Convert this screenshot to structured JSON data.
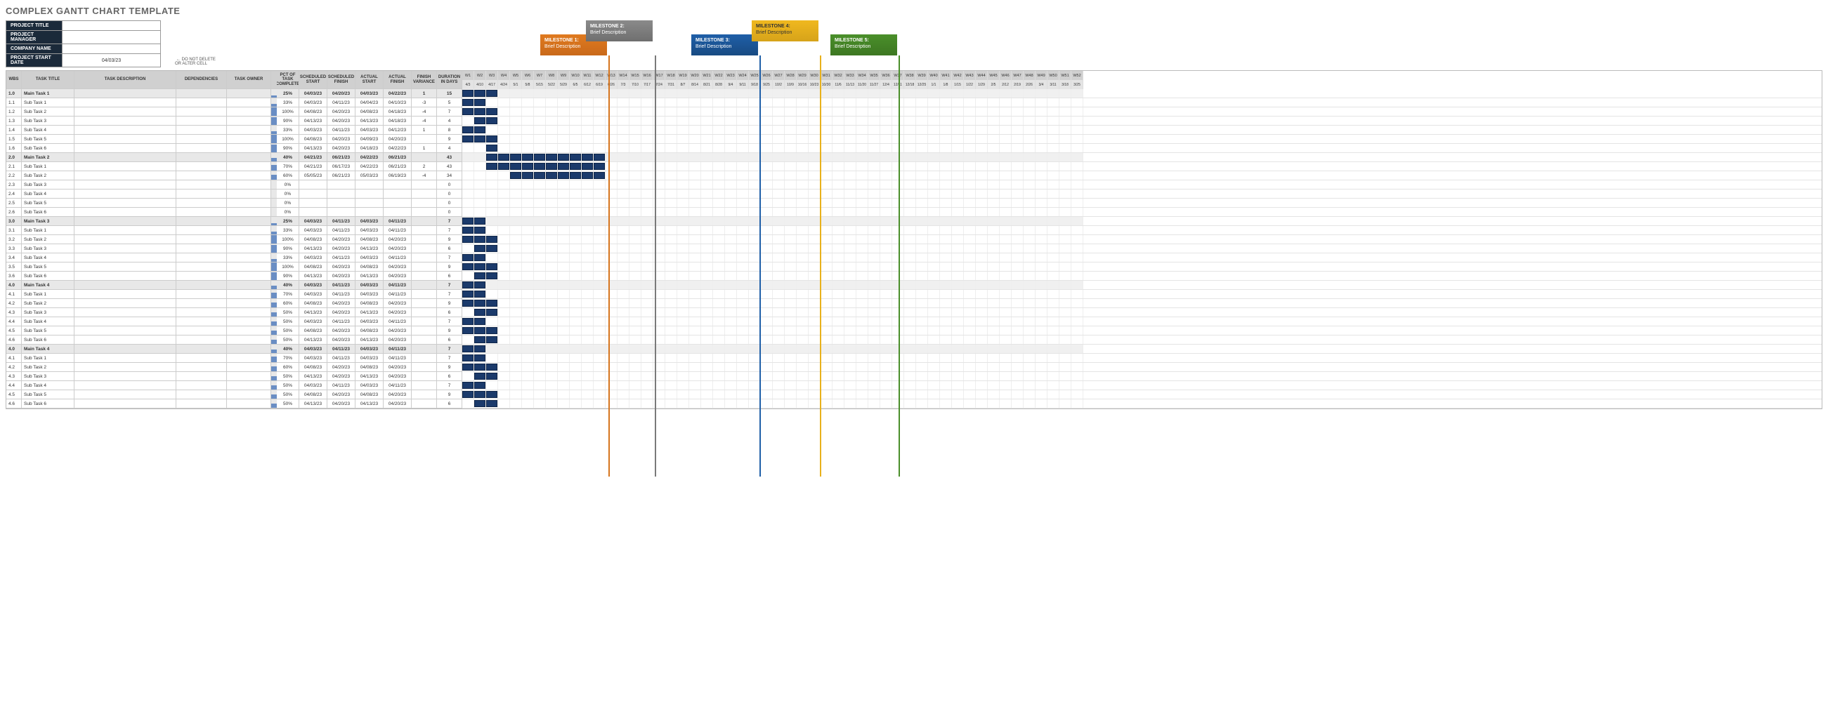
{
  "title": "COMPLEX GANTT CHART TEMPLATE",
  "meta": {
    "labels": [
      "PROJECT TITLE",
      "PROJECT MANAGER",
      "COMPANY NAME",
      "PROJECT START DATE"
    ],
    "values": [
      "",
      "",
      "",
      "04/03/23"
    ]
  },
  "note": "← DO NOT DELETE\n    OR ALTER CELL",
  "milestones": [
    {
      "title": "MILESTONE 1:",
      "desc": "Brief Description",
      "cls": "m1"
    },
    {
      "title": "MILESTONE 2:",
      "desc": "Brief Description",
      "cls": "m2"
    },
    {
      "title": "MILESTONE 3:",
      "desc": "Brief Description",
      "cls": "m3"
    },
    {
      "title": "MILESTONE 4:",
      "desc": "Brief Description",
      "cls": "m4"
    },
    {
      "title": "MILESTONE 5:",
      "desc": "Brief Description",
      "cls": "m5"
    }
  ],
  "headers": {
    "wbs": "WBS",
    "task": "TASK TITLE",
    "desc": "TASK DESCRIPTION",
    "dep": "DEPENDENCIES",
    "owner": "TASK OWNER",
    "pct": "PCT OF TASK\nCOMPLETE",
    "sstart": "SCHEDULED\nSTART",
    "sfinish": "SCHEDULED\nFINISH",
    "astart": "ACTUAL\nSTART",
    "afinish": "ACTUAL\nFINISH",
    "var": "FINISH\nVARIANCE",
    "dur": "DURATION\nIN DAYS"
  },
  "weeks": [
    "W1",
    "W2",
    "W3",
    "W4",
    "W5",
    "W6",
    "W7",
    "W8",
    "W9",
    "W10",
    "W11",
    "W12",
    "W13",
    "W14",
    "W15",
    "W16",
    "W17",
    "W18",
    "W19",
    "W20",
    "W21",
    "W22",
    "W23",
    "W24",
    "W25",
    "W26",
    "W27",
    "W28",
    "W29",
    "W30",
    "W31",
    "W32",
    "W33",
    "W34",
    "W35",
    "W36",
    "W37",
    "W38",
    "W39",
    "W40",
    "W41",
    "W42",
    "W43",
    "W44",
    "W45",
    "W46",
    "W47",
    "W48",
    "W49",
    "W50",
    "W51",
    "W52"
  ],
  "dates": [
    "4/3",
    "4/10",
    "4/17",
    "4/24",
    "5/1",
    "5/8",
    "5/15",
    "5/22",
    "5/29",
    "6/5",
    "6/12",
    "6/19",
    "6/26",
    "7/3",
    "7/10",
    "7/17",
    "7/24",
    "7/31",
    "8/7",
    "8/14",
    "8/21",
    "8/28",
    "9/4",
    "9/11",
    "9/18",
    "9/25",
    "10/2",
    "10/9",
    "10/16",
    "10/23",
    "10/30",
    "11/6",
    "11/13",
    "11/20",
    "11/27",
    "12/4",
    "12/11",
    "12/18",
    "12/25",
    "1/1",
    "1/8",
    "1/15",
    "1/22",
    "1/29",
    "2/5",
    "2/12",
    "2/19",
    "2/26",
    "3/4",
    "3/11",
    "3/18",
    "3/25"
  ],
  "rows": [
    {
      "main": true,
      "wbs": "1.0",
      "task": "Main Task 1",
      "pct": "25%",
      "pctv": 25,
      "ss": "04/03/23",
      "sf": "04/20/23",
      "as": "04/03/23",
      "af": "04/22/23",
      "var": "1",
      "dur": "15",
      "bars": [
        [
          0,
          2
        ]
      ]
    },
    {
      "wbs": "1.1",
      "task": "Sub Task 1",
      "pct": "33%",
      "pctv": 33,
      "ss": "04/03/23",
      "sf": "04/11/23",
      "as": "04/04/23",
      "af": "04/10/23",
      "var": "-3",
      "dur": "5",
      "bars": [
        [
          0,
          1
        ]
      ]
    },
    {
      "wbs": "1.2",
      "task": "Sub Task 2",
      "pct": "100%",
      "pctv": 100,
      "ss": "04/08/23",
      "sf": "04/20/23",
      "as": "04/08/23",
      "af": "04/18/23",
      "var": "-4",
      "dur": "7",
      "bars": [
        [
          0,
          2
        ]
      ]
    },
    {
      "wbs": "1.3",
      "task": "Sub Task 3",
      "pct": "90%",
      "pctv": 90,
      "ss": "04/13/23",
      "sf": "04/20/23",
      "as": "04/13/23",
      "af": "04/18/23",
      "var": "-4",
      "dur": "4",
      "bars": [
        [
          1,
          2
        ]
      ]
    },
    {
      "wbs": "1.4",
      "task": "Sub Task 4",
      "pct": "33%",
      "pctv": 33,
      "ss": "04/03/23",
      "sf": "04/11/23",
      "as": "04/03/23",
      "af": "04/12/23",
      "var": "1",
      "dur": "8",
      "bars": [
        [
          0,
          1
        ]
      ]
    },
    {
      "wbs": "1.5",
      "task": "Sub Task 5",
      "pct": "100%",
      "pctv": 100,
      "ss": "04/08/23",
      "sf": "04/20/23",
      "as": "04/09/23",
      "af": "04/20/23",
      "var": "",
      "dur": "9",
      "bars": [
        [
          0,
          2
        ]
      ]
    },
    {
      "wbs": "1.6",
      "task": "Sub Task 6",
      "pct": "90%",
      "pctv": 90,
      "ss": "04/13/23",
      "sf": "04/20/23",
      "as": "04/18/23",
      "af": "04/22/23",
      "var": "1",
      "dur": "4",
      "bars": [
        [
          2,
          2
        ]
      ]
    },
    {
      "main": true,
      "wbs": "2.0",
      "task": "Main Task 2",
      "pct": "40%",
      "pctv": 40,
      "ss": "04/21/23",
      "sf": "06/21/23",
      "as": "04/22/23",
      "af": "06/21/23",
      "var": "",
      "dur": "43",
      "bars": [
        [
          2,
          11
        ]
      ]
    },
    {
      "wbs": "2.1",
      "task": "Sub Task 1",
      "pct": "70%",
      "pctv": 70,
      "ss": "04/21/23",
      "sf": "06/17/23",
      "as": "04/22/23",
      "af": "06/21/23",
      "var": "2",
      "dur": "43",
      "bars": [
        [
          2,
          11
        ]
      ]
    },
    {
      "wbs": "2.2",
      "task": "Sub Task 2",
      "pct": "60%",
      "pctv": 60,
      "ss": "05/05/23",
      "sf": "06/21/23",
      "as": "05/03/23",
      "af": "06/19/23",
      "var": "-4",
      "dur": "34",
      "bars": [
        [
          4,
          11
        ]
      ]
    },
    {
      "wbs": "2.3",
      "task": "Sub Task 3",
      "pct": "0%",
      "pctv": 0,
      "ss": "",
      "sf": "",
      "as": "",
      "af": "",
      "var": "",
      "dur": "0",
      "bars": []
    },
    {
      "wbs": "2.4",
      "task": "Sub Task 4",
      "pct": "0%",
      "pctv": 0,
      "ss": "",
      "sf": "",
      "as": "",
      "af": "",
      "var": "",
      "dur": "0",
      "bars": []
    },
    {
      "wbs": "2.5",
      "task": "Sub Task 5",
      "pct": "0%",
      "pctv": 0,
      "ss": "",
      "sf": "",
      "as": "",
      "af": "",
      "var": "",
      "dur": "0",
      "bars": []
    },
    {
      "wbs": "2.6",
      "task": "Sub Task 6",
      "pct": "0%",
      "pctv": 0,
      "ss": "",
      "sf": "",
      "as": "",
      "af": "",
      "var": "",
      "dur": "0",
      "bars": []
    },
    {
      "main": true,
      "wbs": "3.0",
      "task": "Main Task 3",
      "pct": "25%",
      "pctv": 25,
      "ss": "04/03/23",
      "sf": "04/11/23",
      "as": "04/03/23",
      "af": "04/11/23",
      "var": "",
      "dur": "7",
      "bars": [
        [
          0,
          1
        ]
      ]
    },
    {
      "wbs": "3.1",
      "task": "Sub Task 1",
      "pct": "33%",
      "pctv": 33,
      "ss": "04/03/23",
      "sf": "04/11/23",
      "as": "04/03/23",
      "af": "04/11/23",
      "var": "",
      "dur": "7",
      "bars": [
        [
          0,
          1
        ]
      ]
    },
    {
      "wbs": "3.2",
      "task": "Sub Task 2",
      "pct": "100%",
      "pctv": 100,
      "ss": "04/08/23",
      "sf": "04/20/23",
      "as": "04/08/23",
      "af": "04/20/23",
      "var": "",
      "dur": "9",
      "bars": [
        [
          0,
          2
        ]
      ]
    },
    {
      "wbs": "3.3",
      "task": "Sub Task 3",
      "pct": "90%",
      "pctv": 90,
      "ss": "04/13/23",
      "sf": "04/20/23",
      "as": "04/13/23",
      "af": "04/20/23",
      "var": "",
      "dur": "6",
      "bars": [
        [
          1,
          2
        ]
      ]
    },
    {
      "wbs": "3.4",
      "task": "Sub Task 4",
      "pct": "33%",
      "pctv": 33,
      "ss": "04/03/23",
      "sf": "04/11/23",
      "as": "04/03/23",
      "af": "04/11/23",
      "var": "",
      "dur": "7",
      "bars": [
        [
          0,
          1
        ]
      ]
    },
    {
      "wbs": "3.5",
      "task": "Sub Task 5",
      "pct": "100%",
      "pctv": 100,
      "ss": "04/08/23",
      "sf": "04/20/23",
      "as": "04/08/23",
      "af": "04/20/23",
      "var": "",
      "dur": "9",
      "bars": [
        [
          0,
          2
        ]
      ]
    },
    {
      "wbs": "3.6",
      "task": "Sub Task 6",
      "pct": "90%",
      "pctv": 90,
      "ss": "04/13/23",
      "sf": "04/20/23",
      "as": "04/13/23",
      "af": "04/20/23",
      "var": "",
      "dur": "6",
      "bars": [
        [
          1,
          2
        ]
      ]
    },
    {
      "main": true,
      "wbs": "4.0",
      "task": "Main Task 4",
      "pct": "40%",
      "pctv": 40,
      "ss": "04/03/23",
      "sf": "04/11/23",
      "as": "04/03/23",
      "af": "04/11/23",
      "var": "",
      "dur": "7",
      "bars": [
        [
          0,
          1
        ]
      ]
    },
    {
      "wbs": "4.1",
      "task": "Sub Task 1",
      "pct": "70%",
      "pctv": 70,
      "ss": "04/03/23",
      "sf": "04/11/23",
      "as": "04/03/23",
      "af": "04/11/23",
      "var": "",
      "dur": "7",
      "bars": [
        [
          0,
          1
        ]
      ]
    },
    {
      "wbs": "4.2",
      "task": "Sub Task 2",
      "pct": "60%",
      "pctv": 60,
      "ss": "04/08/23",
      "sf": "04/20/23",
      "as": "04/08/23",
      "af": "04/20/23",
      "var": "",
      "dur": "9",
      "bars": [
        [
          0,
          2
        ]
      ]
    },
    {
      "wbs": "4.3",
      "task": "Sub Task 3",
      "pct": "50%",
      "pctv": 50,
      "ss": "04/13/23",
      "sf": "04/20/23",
      "as": "04/13/23",
      "af": "04/20/23",
      "var": "",
      "dur": "6",
      "bars": [
        [
          1,
          2
        ]
      ]
    },
    {
      "wbs": "4.4",
      "task": "Sub Task 4",
      "pct": "50%",
      "pctv": 50,
      "ss": "04/03/23",
      "sf": "04/11/23",
      "as": "04/03/23",
      "af": "04/11/23",
      "var": "",
      "dur": "7",
      "bars": [
        [
          0,
          1
        ]
      ]
    },
    {
      "wbs": "4.5",
      "task": "Sub Task 5",
      "pct": "50%",
      "pctv": 50,
      "ss": "04/08/23",
      "sf": "04/20/23",
      "as": "04/08/23",
      "af": "04/20/23",
      "var": "",
      "dur": "9",
      "bars": [
        [
          0,
          2
        ]
      ]
    },
    {
      "wbs": "4.6",
      "task": "Sub Task 6",
      "pct": "50%",
      "pctv": 50,
      "ss": "04/13/23",
      "sf": "04/20/23",
      "as": "04/13/23",
      "af": "04/20/23",
      "var": "",
      "dur": "6",
      "bars": [
        [
          1,
          2
        ]
      ]
    },
    {
      "main": true,
      "wbs": "4.0",
      "task": "Main Task 4",
      "pct": "40%",
      "pctv": 40,
      "ss": "04/03/23",
      "sf": "04/11/23",
      "as": "04/03/23",
      "af": "04/11/23",
      "var": "",
      "dur": "7",
      "bars": [
        [
          0,
          1
        ]
      ]
    },
    {
      "wbs": "4.1",
      "task": "Sub Task 1",
      "pct": "70%",
      "pctv": 70,
      "ss": "04/03/23",
      "sf": "04/11/23",
      "as": "04/03/23",
      "af": "04/11/23",
      "var": "",
      "dur": "7",
      "bars": [
        [
          0,
          1
        ]
      ]
    },
    {
      "wbs": "4.2",
      "task": "Sub Task 2",
      "pct": "60%",
      "pctv": 60,
      "ss": "04/08/23",
      "sf": "04/20/23",
      "as": "04/08/23",
      "af": "04/20/23",
      "var": "",
      "dur": "9",
      "bars": [
        [
          0,
          2
        ]
      ]
    },
    {
      "wbs": "4.3",
      "task": "Sub Task 3",
      "pct": "50%",
      "pctv": 50,
      "ss": "04/13/23",
      "sf": "04/20/23",
      "as": "04/13/23",
      "af": "04/20/23",
      "var": "",
      "dur": "6",
      "bars": [
        [
          1,
          2
        ]
      ]
    },
    {
      "wbs": "4.4",
      "task": "Sub Task 4",
      "pct": "50%",
      "pctv": 50,
      "ss": "04/03/23",
      "sf": "04/11/23",
      "as": "04/03/23",
      "af": "04/11/23",
      "var": "",
      "dur": "7",
      "bars": [
        [
          0,
          1
        ]
      ]
    },
    {
      "wbs": "4.5",
      "task": "Sub Task 5",
      "pct": "50%",
      "pctv": 50,
      "ss": "04/08/23",
      "sf": "04/20/23",
      "as": "04/08/23",
      "af": "04/20/23",
      "var": "",
      "dur": "9",
      "bars": [
        [
          0,
          2
        ]
      ]
    },
    {
      "wbs": "4.6",
      "task": "Sub Task 6",
      "pct": "50%",
      "pctv": 50,
      "ss": "04/13/23",
      "sf": "04/20/23",
      "as": "04/13/23",
      "af": "04/20/23",
      "var": "",
      "dur": "6",
      "bars": [
        [
          1,
          2
        ]
      ]
    }
  ],
  "chart_data": {
    "type": "bar",
    "title": "Complex Gantt Chart",
    "x": [
      "W1",
      "W2",
      "W3",
      "W4",
      "W5",
      "W6",
      "W7",
      "W8",
      "W9",
      "W10",
      "W11",
      "W12"
    ],
    "series": [
      {
        "name": "Main Task 1",
        "start": 0,
        "end": 2,
        "pct": 25
      },
      {
        "name": "Sub Task 1.1",
        "start": 0,
        "end": 1,
        "pct": 33
      },
      {
        "name": "Sub Task 1.2",
        "start": 0,
        "end": 2,
        "pct": 100
      },
      {
        "name": "Sub Task 1.3",
        "start": 1,
        "end": 2,
        "pct": 90
      },
      {
        "name": "Sub Task 1.4",
        "start": 0,
        "end": 1,
        "pct": 33
      },
      {
        "name": "Sub Task 1.5",
        "start": 0,
        "end": 2,
        "pct": 100
      },
      {
        "name": "Sub Task 1.6",
        "start": 2,
        "end": 2,
        "pct": 90
      },
      {
        "name": "Main Task 2",
        "start": 2,
        "end": 11,
        "pct": 40
      },
      {
        "name": "Sub Task 2.1",
        "start": 2,
        "end": 11,
        "pct": 70
      },
      {
        "name": "Sub Task 2.2",
        "start": 4,
        "end": 11,
        "pct": 60
      },
      {
        "name": "Main Task 3",
        "start": 0,
        "end": 1,
        "pct": 25
      },
      {
        "name": "Main Task 4",
        "start": 0,
        "end": 1,
        "pct": 40
      }
    ],
    "milestones": [
      {
        "name": "Milestone 1",
        "week": 7
      },
      {
        "name": "Milestone 2",
        "week": 11
      },
      {
        "name": "Milestone 3",
        "week": 20
      },
      {
        "name": "Milestone 4",
        "week": 25
      },
      {
        "name": "Milestone 5",
        "week": 31
      }
    ]
  }
}
